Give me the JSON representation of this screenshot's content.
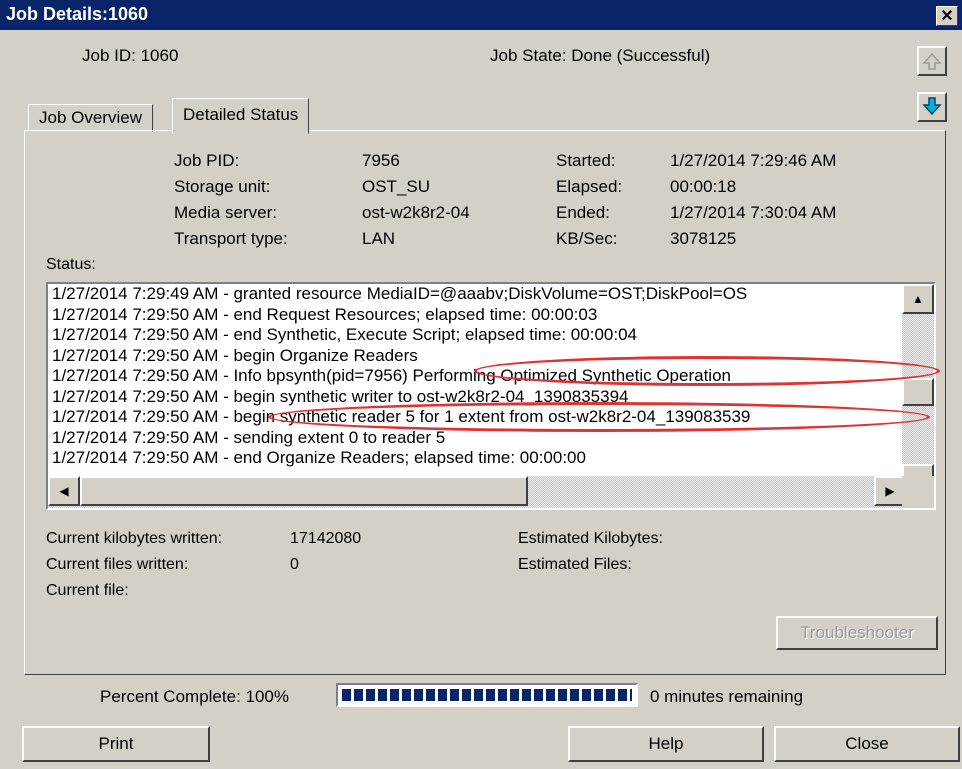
{
  "window": {
    "title": "Job Details:1060",
    "close_glyph": "✕"
  },
  "header": {
    "job_id": "Job ID: 1060",
    "job_state": "Job State: Done (Successful)",
    "up_icon": "arrow-up-icon",
    "down_icon": "arrow-down-icon"
  },
  "tabs": [
    {
      "label": "Job Overview",
      "selected": false
    },
    {
      "label": "Detailed Status",
      "selected": true
    }
  ],
  "details": {
    "left": [
      {
        "label": "Job PID:",
        "value": "7956"
      },
      {
        "label": "Storage unit:",
        "value": "OST_SU"
      },
      {
        "label": "Media server:",
        "value": "ost-w2k8r2-04"
      },
      {
        "label": "Transport type:",
        "value": "LAN"
      }
    ],
    "right": [
      {
        "label": "Started:",
        "value": "1/27/2014 7:29:46 AM"
      },
      {
        "label": "Elapsed:",
        "value": "00:00:18"
      },
      {
        "label": "Ended:",
        "value": "1/27/2014 7:30:04 AM"
      },
      {
        "label": "KB/Sec:",
        "value": "3078125"
      }
    ]
  },
  "status": {
    "label": "Status:",
    "lines": [
      "1/27/2014 7:29:49 AM - granted resource MediaID=@aaabv;DiskVolume=OST;DiskPool=OS",
      "1/27/2014 7:29:50 AM - end Request Resources; elapsed time: 00:00:03",
      "1/27/2014 7:29:50 AM - end Synthetic, Execute Script; elapsed time: 00:00:04",
      "1/27/2014 7:29:50 AM - begin Organize Readers",
      "1/27/2014 7:29:50 AM - Info bpsynth(pid=7956) Performing Optimized Synthetic Operation",
      "1/27/2014 7:29:50 AM - begin synthetic writer to ost-w2k8r2-04_1390835394",
      "1/27/2014 7:29:50 AM - begin synthetic reader 5 for 1 extent from ost-w2k8r2-04_139083539",
      "1/27/2014 7:29:50 AM - sending extent 0 to reader 5",
      "1/27/2014 7:29:50 AM - end Organize Readers; elapsed time: 00:00:00"
    ],
    "scroll_up_glyph": "▲",
    "scroll_down_glyph": "▼",
    "scroll_left_glyph": "◀",
    "scroll_right_glyph": "▶"
  },
  "counters": {
    "kb_written_label": "Current kilobytes written:",
    "kb_written_value": "17142080",
    "files_written_label": "Current files written:",
    "files_written_value": "0",
    "current_file_label": "Current file:",
    "est_kb_label": "Estimated Kilobytes:",
    "est_files_label": "Estimated Files:"
  },
  "troubleshooter_label": "Troubleshooter",
  "progress": {
    "label": "Percent Complete: 100%",
    "fraction": 1.0,
    "remaining": "0 minutes remaining"
  },
  "buttons": {
    "print": "Print",
    "help": "Help",
    "close": "Close"
  },
  "colors": {
    "title_bar": "#0a246a",
    "progress": "#0a246a",
    "annotation": "#e03232",
    "arrow_down": "#00b4d8"
  }
}
